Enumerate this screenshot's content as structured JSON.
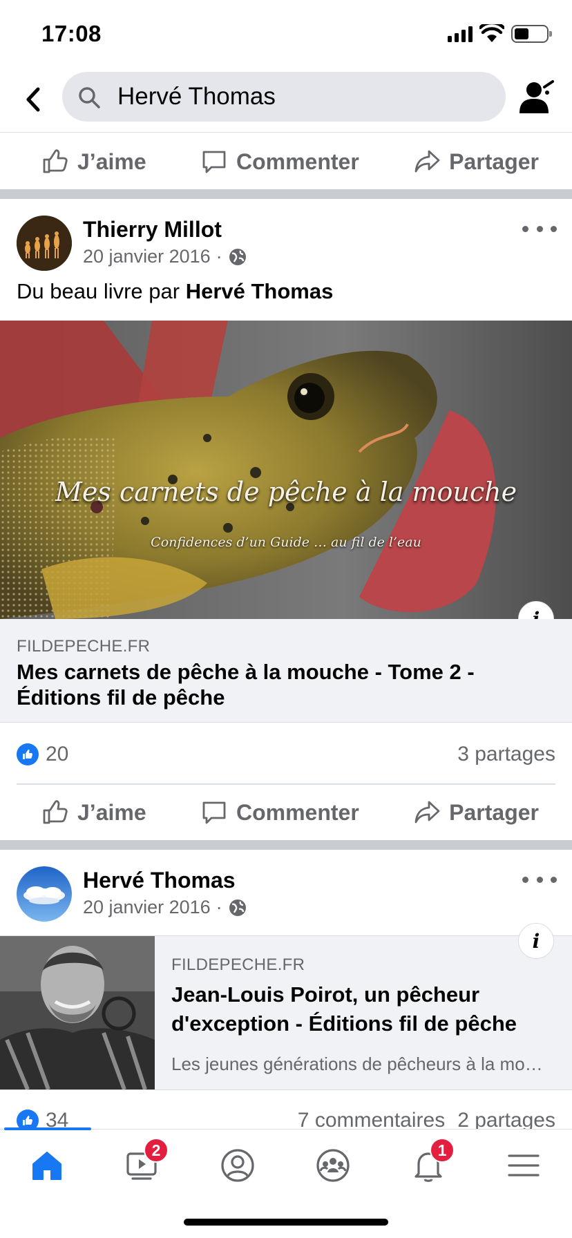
{
  "status_bar": {
    "time": "17:08"
  },
  "search": {
    "query": "Hervé Thomas"
  },
  "actions": {
    "like": "J’aime",
    "comment": "Commenter",
    "share": "Partager"
  },
  "post1": {
    "author": "Thierry Millot",
    "date": "20 janvier 2016",
    "text_prefix": "Du beau livre par ",
    "text_mention": "Hervé Thomas",
    "image_title": "Mes carnets de pêche à la mouche",
    "image_subtitle": "Confidences d’un Guide … au fil de l’eau",
    "link_domain": "FILDEPECHE.FR",
    "link_title": "Mes carnets de pêche à la mouche - Tome 2 - Éditions fil de pêche",
    "like_count": "20",
    "shares": "3 partages"
  },
  "post2": {
    "author": "Hervé Thomas",
    "date": "20 janvier 2016",
    "link_domain": "FILDEPECHE.FR",
    "link_title": "Jean-Louis Poirot, un pêcheur d'exception - Éditions fil de pêche",
    "link_description": "Les jeunes générations de pêcheurs à la mouche",
    "like_count": "34",
    "comments": "7 commentaires",
    "shares": "2 partages"
  },
  "tab_bar": {
    "active_tab": "home",
    "watch_badge": "2",
    "notifications_badge": "1"
  },
  "colors": {
    "accent": "#1877f2",
    "badge": "#e41e3f",
    "secondary_text": "#65676b"
  },
  "icons": [
    "back-arrow-icon",
    "search-icon",
    "person-icon",
    "like-icon",
    "comment-icon",
    "share-icon",
    "globe-icon",
    "more-icon",
    "info-icon",
    "home-icon",
    "watch-icon",
    "profile-icon",
    "groups-icon",
    "bell-icon",
    "menu-icon"
  ]
}
